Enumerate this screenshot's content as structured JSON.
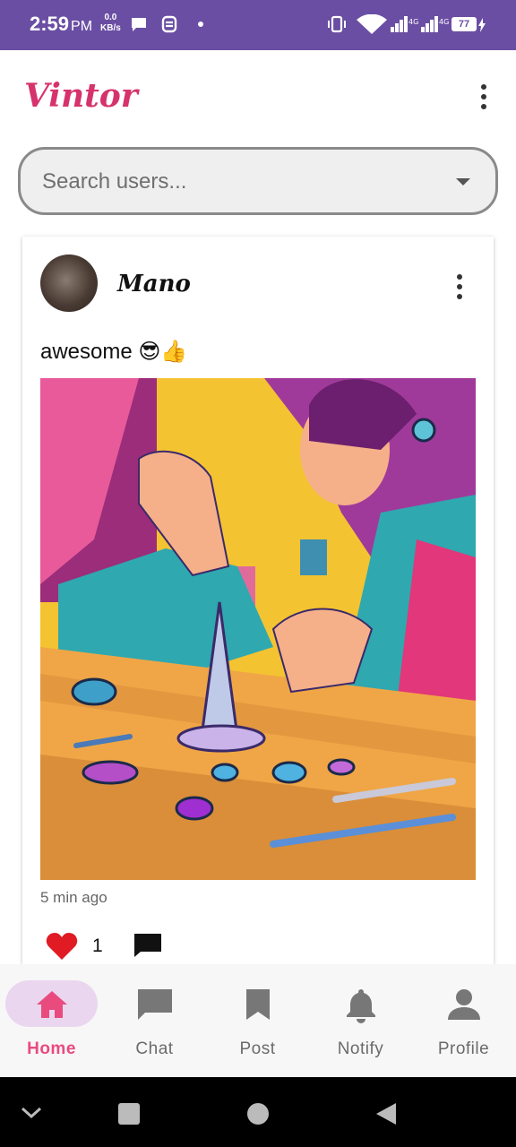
{
  "status_bar": {
    "time": "2:59",
    "ampm": "PM",
    "speed_value": "0.0",
    "speed_unit": "KB/s",
    "network_1": "4G",
    "network_2": "4G",
    "battery": "77"
  },
  "header": {
    "app_name": "Vintor"
  },
  "search": {
    "placeholder": "Search users..."
  },
  "post": {
    "username": "Mano",
    "caption": "awesome 😎👍",
    "time": "5 min ago",
    "likes": "1"
  },
  "nav": {
    "items": [
      {
        "label": "Home",
        "icon": "home-icon",
        "active": true
      },
      {
        "label": "Chat",
        "icon": "chat-icon",
        "active": false
      },
      {
        "label": "Post",
        "icon": "bookmark-icon",
        "active": false
      },
      {
        "label": "Notify",
        "icon": "bell-icon",
        "active": false
      },
      {
        "label": "Profile",
        "icon": "person-icon",
        "active": false
      }
    ]
  },
  "colors": {
    "status_bar": "#6a4ea3",
    "brand": "#d6336c",
    "active_nav": "#e94b7f",
    "like": "#e01b24"
  }
}
